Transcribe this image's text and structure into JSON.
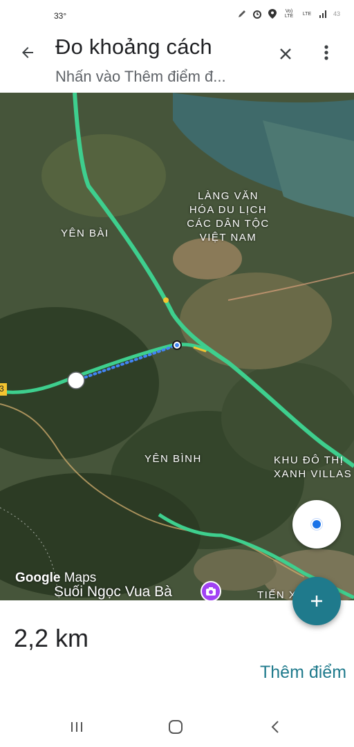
{
  "status_bar": {
    "temperature": "33°",
    "network_label": "Vo) LTE",
    "lte_label": "LTE",
    "battery_text": "43"
  },
  "header": {
    "title": "Đo khoảng cách",
    "subtitle": "Nhấn vào Thêm điểm đ..."
  },
  "map": {
    "labels": {
      "culture_village": [
        "LÀNG VĂN",
        "HÓA DU LỊCH",
        "CÁC DÂN TỘC",
        "VIỆT NAM"
      ],
      "yen_bai": "YÊN BÀI",
      "yen_binh": "YÊN BÌNH",
      "khu_do_thi": [
        "KHU ĐÔ THỊ",
        "XANH VILLAS"
      ],
      "tien_xuan": "TIẾN X",
      "road_number": "3"
    },
    "logo_google": "Google",
    "logo_maps": "Maps",
    "poi": "Suối Ngọc Vua Bà",
    "colors": {
      "highway": "#3ecf8e",
      "measure_line": "#4285f4",
      "poi": "#a142f4"
    }
  },
  "measurement": {
    "distance": "2,2 km",
    "add_point_label": "Thêm điểm"
  },
  "icons": {
    "back": "arrow-back-icon",
    "close": "close-icon",
    "more": "more-vert-icon",
    "my_location": "my-location-icon",
    "add": "add-icon",
    "nav_recents": "recents-icon",
    "nav_home": "home-icon",
    "nav_back": "nav-back-icon"
  }
}
